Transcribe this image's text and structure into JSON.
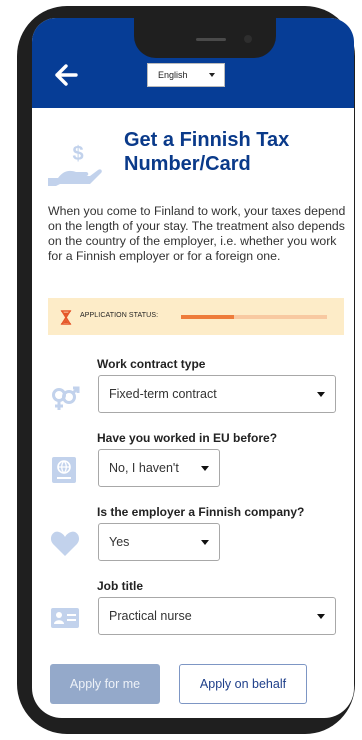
{
  "header": {
    "back_icon": "arrow-left-icon",
    "language": {
      "selected": "English"
    }
  },
  "title": {
    "icon": "hand-dollar-icon",
    "text": "Get a Finnish Tax Number/Card"
  },
  "intro": "When you come to Finland to work, your taxes depend on the length of your stay. The treatment also depends on the country of the employer, i.e. whether you work for a Finnish employer or for a foreign one.",
  "status": {
    "label": "APPLICATION STATUS:",
    "progress": 0.36,
    "icon": "hourglass-icon"
  },
  "questions": [
    {
      "label": "Work contract type",
      "value": "Fixed-term contract",
      "icon": "gender-icon"
    },
    {
      "label": "Have you worked in EU before?",
      "value": "No, I haven't",
      "icon": "passport-icon"
    },
    {
      "label": "Is the employer a Finnish company?",
      "value": "Yes",
      "icon": "heart-icon"
    },
    {
      "label": "Job title",
      "value": "Practical nurse",
      "icon": "id-card-icon"
    }
  ],
  "buttons": {
    "apply_self": "Apply for me",
    "apply_behalf": "Apply on behalf"
  },
  "colors": {
    "header": "#063d96",
    "accent": "#0a3a8a",
    "icon": "#c2d2ec",
    "status_bg": "#fdecc8",
    "progress": "#ee7c3b"
  }
}
